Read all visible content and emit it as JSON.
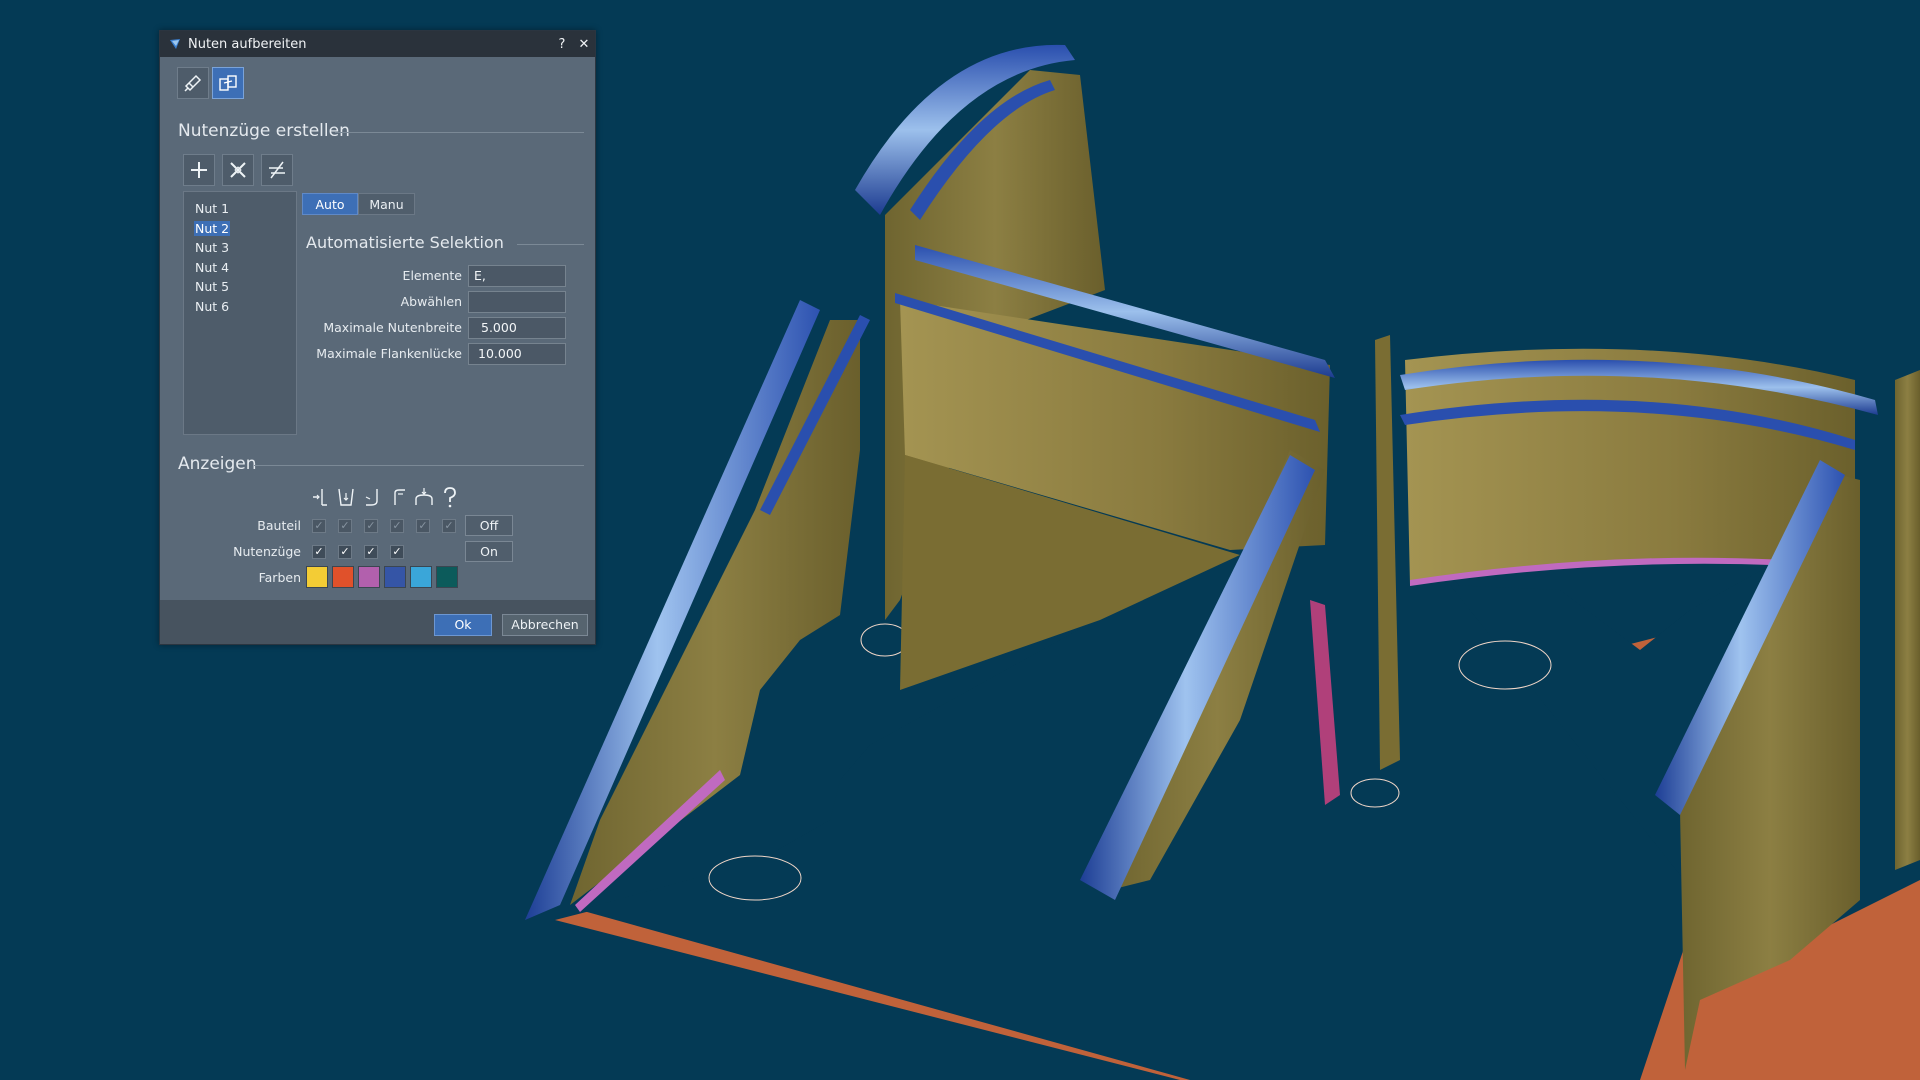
{
  "dialog": {
    "title": "Nuten aufbereiten",
    "help_label": "?",
    "close_label": "✕",
    "section_create": "Nutenzüge erstellen",
    "grooves": [
      "Nut 1",
      "Nut 2",
      "Nut 3",
      "Nut 4",
      "Nut 5",
      "Nut 6"
    ],
    "selected_groove": "Nut 2",
    "mode_tabs": {
      "auto": "Auto",
      "manu": "Manu",
      "active": "Auto"
    },
    "section_auto": "Automatisierte Selektion",
    "fields": {
      "elemente": {
        "label": "Elemente",
        "value": "E,"
      },
      "abwaehlen": {
        "label": "Abwählen",
        "value": ""
      },
      "max_nutenbreite": {
        "label": "Maximale Nutenbreite",
        "value": "5.000"
      },
      "max_flankenluecke": {
        "label": "Maximale Flankenlücke",
        "value": "10.000"
      }
    },
    "section_show": "Anzeigen",
    "display_type_icons": [
      "groove-type-1-icon",
      "groove-type-2-icon",
      "groove-type-3-icon",
      "groove-type-4-icon",
      "groove-type-5-icon",
      "unknown-type-icon"
    ],
    "rows": {
      "bauteil": {
        "label": "Bauteil",
        "toggle": "Off",
        "checks": [
          true,
          true,
          true,
          true,
          true,
          true
        ]
      },
      "nutenzuege": {
        "label": "Nutenzüge",
        "checks": [
          true,
          true,
          true,
          true
        ],
        "toggle": "On"
      },
      "farben": {
        "label": "Farben",
        "colors": [
          "#f3cc35",
          "#e0512b",
          "#b260ad",
          "#3555a6",
          "#3aa6d9",
          "#0c5b5b"
        ]
      }
    },
    "buttons": {
      "ok": "Ok",
      "cancel": "Abbrechen"
    }
  },
  "colors": {
    "background": "#043a55",
    "wall": "#8a7a3e",
    "base": "#c0623a",
    "groove": "#3a5fb5",
    "accent": "#3d6fb6"
  }
}
